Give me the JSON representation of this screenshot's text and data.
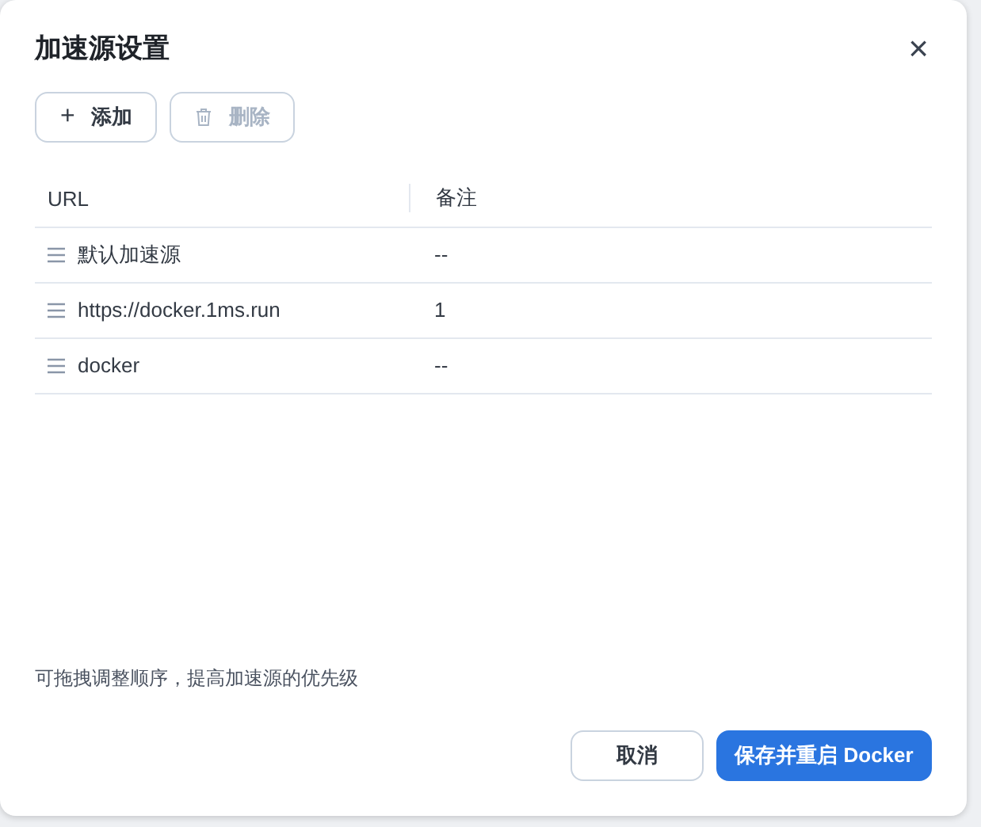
{
  "dialog": {
    "title": "加速源设置",
    "close": "×"
  },
  "toolbar": [
    {
      "kind": "add",
      "icon": "+",
      "label": "添加",
      "disabled": false
    },
    {
      "kind": "delete",
      "label": "删除",
      "disabled": true
    }
  ],
  "table": {
    "columns": [
      "URL",
      "备注"
    ],
    "rows": [
      {
        "url": "默认加速源",
        "note": "--"
      },
      {
        "url": "https://docker.1ms.run",
        "note": "1"
      },
      {
        "url": "docker",
        "note": "--"
      }
    ]
  },
  "hint": "可拖拽调整顺序，提高加速源的优先级",
  "buttons": [
    {
      "label": "取消",
      "primary": false
    },
    {
      "label": "保存并重启 Docker",
      "primary": true
    }
  ]
}
